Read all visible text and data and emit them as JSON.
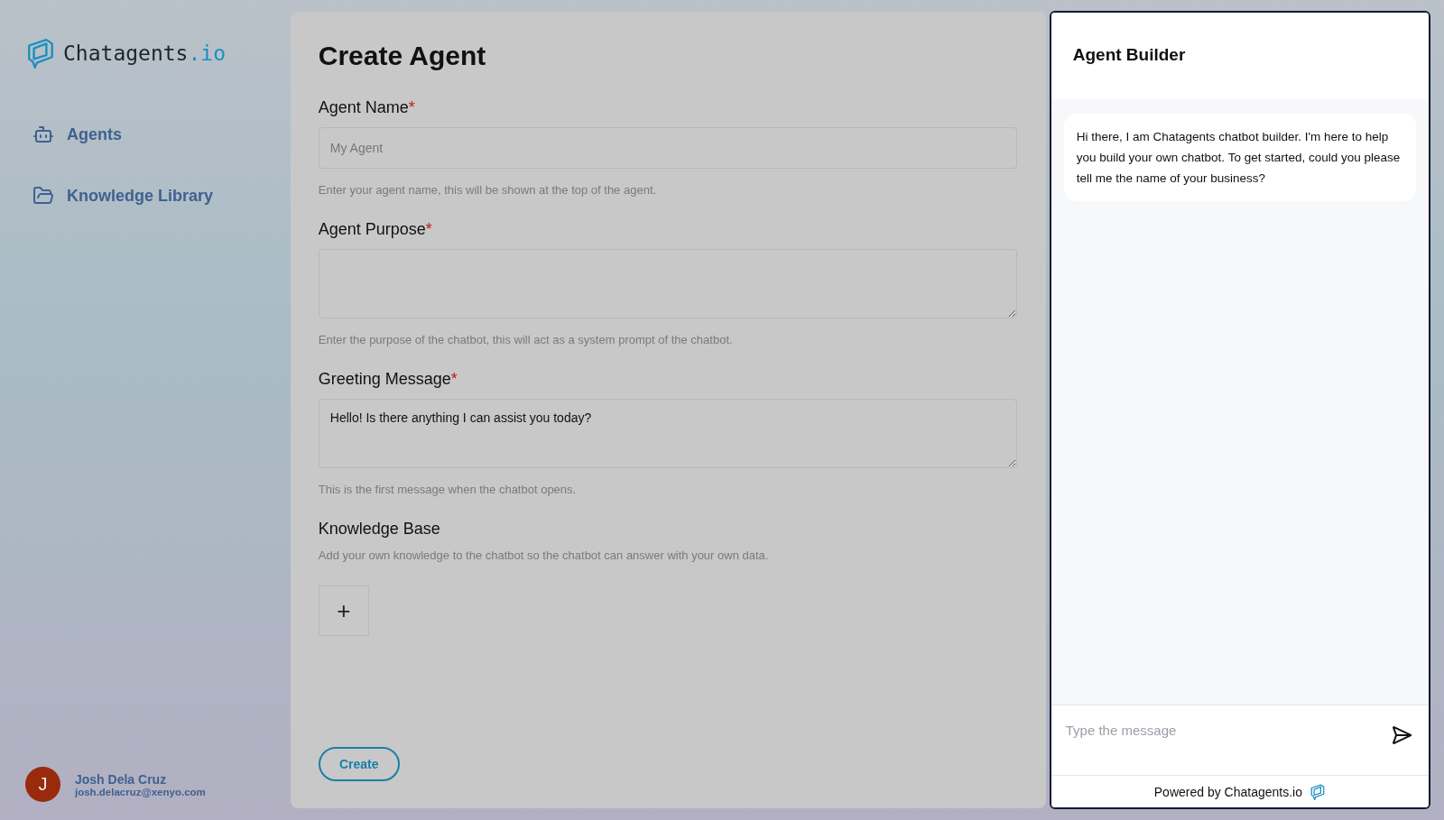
{
  "brand": {
    "name": "Chatagents",
    "suffix": ".io"
  },
  "sidebar": {
    "items": [
      {
        "label": "Agents",
        "selected": false
      },
      {
        "label": "Knowledge Library",
        "selected": false
      }
    ]
  },
  "user": {
    "initial": "J",
    "name": "Josh Dela Cruz",
    "email": "josh.delacruz@xenyo.com"
  },
  "form": {
    "title": "Create Agent",
    "fields": [
      {
        "kind": "input",
        "label": "Agent Name",
        "required_mark": "*",
        "placeholder": "My Agent",
        "hint": "Enter your agent name, this will be shown at the top of the agent."
      },
      {
        "kind": "textarea",
        "label": "Agent Purpose",
        "required_mark": "*",
        "hint": "Enter the purpose of the chatbot, this will act as a system prompt of the chatbot."
      },
      {
        "kind": "textarea",
        "label": "Greeting Message",
        "required_mark": "*",
        "value": "Hello! Is there anything I can assist you today?",
        "hint": "This is the first message when the chatbot opens."
      },
      {
        "kind": "add",
        "label": "Knowledge Base",
        "hint": "Add your own knowledge to the chatbot so the chatbot can answer with your own data.",
        "button": "+"
      }
    ],
    "submit": "Create"
  },
  "chat": {
    "title": "Agent Builder",
    "messages": [
      {
        "text": "Hi there, I am Chatagents chatbot builder. I'm here to help you build your own chatbot. To get started, could you please tell me the name of your business?"
      }
    ],
    "placeholder": "Type the message",
    "footer": "Powered by Chatagents.io"
  }
}
